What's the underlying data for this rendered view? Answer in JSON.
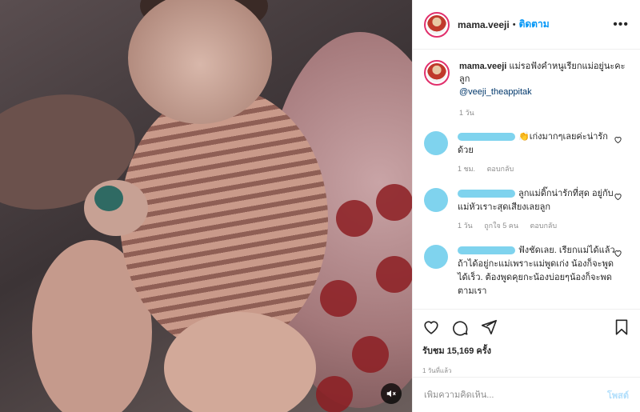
{
  "post": {
    "username": "mama.veeji",
    "follow_label": "ติดตาม",
    "dot": "•",
    "more_icon": "more-horizontal-icon"
  },
  "caption": {
    "username": "mama.veeji",
    "text": "แม่รอฟังคำหนูเรียกแม่อยู่นะคะลูก",
    "mention": "@veeji_theappitak",
    "time": "1 วัน"
  },
  "comments": [
    {
      "text": "👏เก่งมากๆเลยค่ะน่ารักด้วย",
      "time": "1 ชม.",
      "reply": "ตอบกลับ",
      "likes": ""
    },
    {
      "text": "ลูกแม่ดิ๊กน่ารักที่สุด อยู่กับแม่หัวเราะสุดเสียงเลยลูก",
      "time": "1 วัน",
      "likes": "ถูกใจ 5 คน",
      "reply": "ตอบกลับ"
    },
    {
      "text": "ฟังชัดเลย. เรียกแม่ได้แล้ว ถ้าได้อยู่กะแม่เพราะแม่พูดเก่ง น้องก็จะพูดได้เร็ว. ต้องพูดคุยกะน้องบ่อยๆน้องก็จะพดตามเรา",
      "time": "",
      "likes": "",
      "reply": ""
    }
  ],
  "stats": {
    "likes": "รับชม 15,169 ครั้ง",
    "posted": "1 วันที่แล้ว"
  },
  "composer": {
    "placeholder": "เพิ่มความคิดเห็น...",
    "post_label": "โพสต์"
  },
  "colors": {
    "accent": "#0095f6",
    "ring": "#e1306c",
    "redacted": "#7fd3ee"
  }
}
